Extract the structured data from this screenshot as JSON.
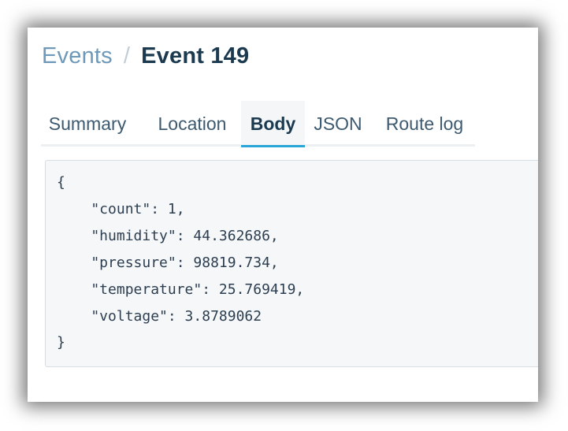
{
  "breadcrumb": {
    "parent": "Events",
    "separator": "/",
    "current": "Event 149"
  },
  "tabs": [
    {
      "label": "Summary",
      "active": false
    },
    {
      "label": "Location",
      "active": false
    },
    {
      "label": "Body",
      "active": true
    },
    {
      "label": "JSON",
      "active": false
    },
    {
      "label": "Route log",
      "active": false
    }
  ],
  "body": {
    "lines": [
      "{",
      "    \"count\": 1,",
      "    \"humidity\": 44.362686,",
      "    \"pressure\": 98819.734,",
      "    \"temperature\": 25.769419,",
      "    \"voltage\": 3.8789062",
      "}"
    ]
  },
  "colors": {
    "accent": "#2aa6d6",
    "link": "#6e99b9",
    "heading": "#1c3a4f"
  }
}
